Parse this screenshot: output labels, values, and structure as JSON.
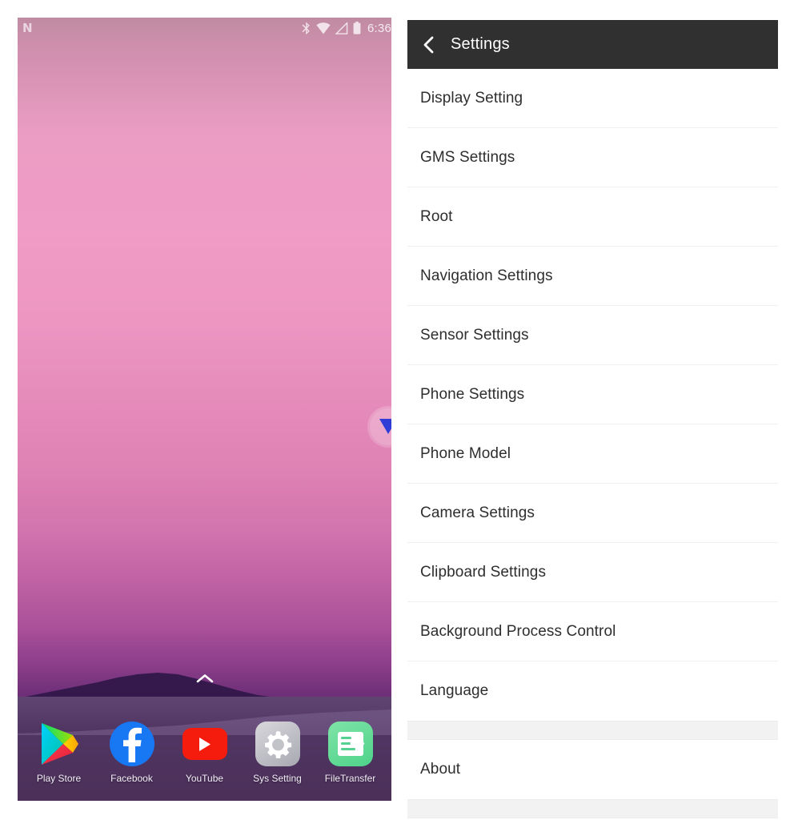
{
  "phone": {
    "statusbar": {
      "logo": "N",
      "icons": [
        "bluetooth-icon",
        "wifi-icon",
        "signal-icon",
        "battery-icon"
      ],
      "clock": "6:36"
    },
    "drawer_arrow_icon": "chevron-up-icon",
    "touch_pointer_icon": "cursor-pointer-icon",
    "dock": [
      {
        "label": "Play Store",
        "icon": "play-store-icon"
      },
      {
        "label": "Facebook",
        "icon": "facebook-icon"
      },
      {
        "label": "YouTube",
        "icon": "youtube-icon"
      },
      {
        "label": "Sys Setting",
        "icon": "gear-icon"
      },
      {
        "label": "FileTransfer",
        "icon": "file-transfer-icon"
      }
    ],
    "wallpaper_colors": {
      "sky_top": "#c08ca2",
      "sky_mid": "#ef9cc6",
      "sky_bottom": "#6e2f78",
      "mountain": "#3a1f51",
      "ground": "#574067"
    }
  },
  "settings": {
    "appbar": {
      "back_icon": "back-chevron-icon",
      "title": "Settings",
      "bg_color": "#303030"
    },
    "items": [
      {
        "label": "Display Setting",
        "type": "item"
      },
      {
        "label": "GMS Settings",
        "type": "item"
      },
      {
        "label": "Root",
        "type": "item"
      },
      {
        "label": "Navigation Settings",
        "type": "item"
      },
      {
        "label": "Sensor Settings",
        "type": "item"
      },
      {
        "label": "Phone Settings",
        "type": "item"
      },
      {
        "label": "Phone Model",
        "type": "item"
      },
      {
        "label": "Camera Settings",
        "type": "item"
      },
      {
        "label": "Clipboard Settings",
        "type": "item"
      },
      {
        "label": "Background Process Control",
        "type": "item"
      },
      {
        "label": "Language",
        "type": "item"
      },
      {
        "label": "",
        "type": "spacer"
      },
      {
        "label": "About",
        "type": "item"
      },
      {
        "label": "",
        "type": "spacer"
      }
    ]
  }
}
